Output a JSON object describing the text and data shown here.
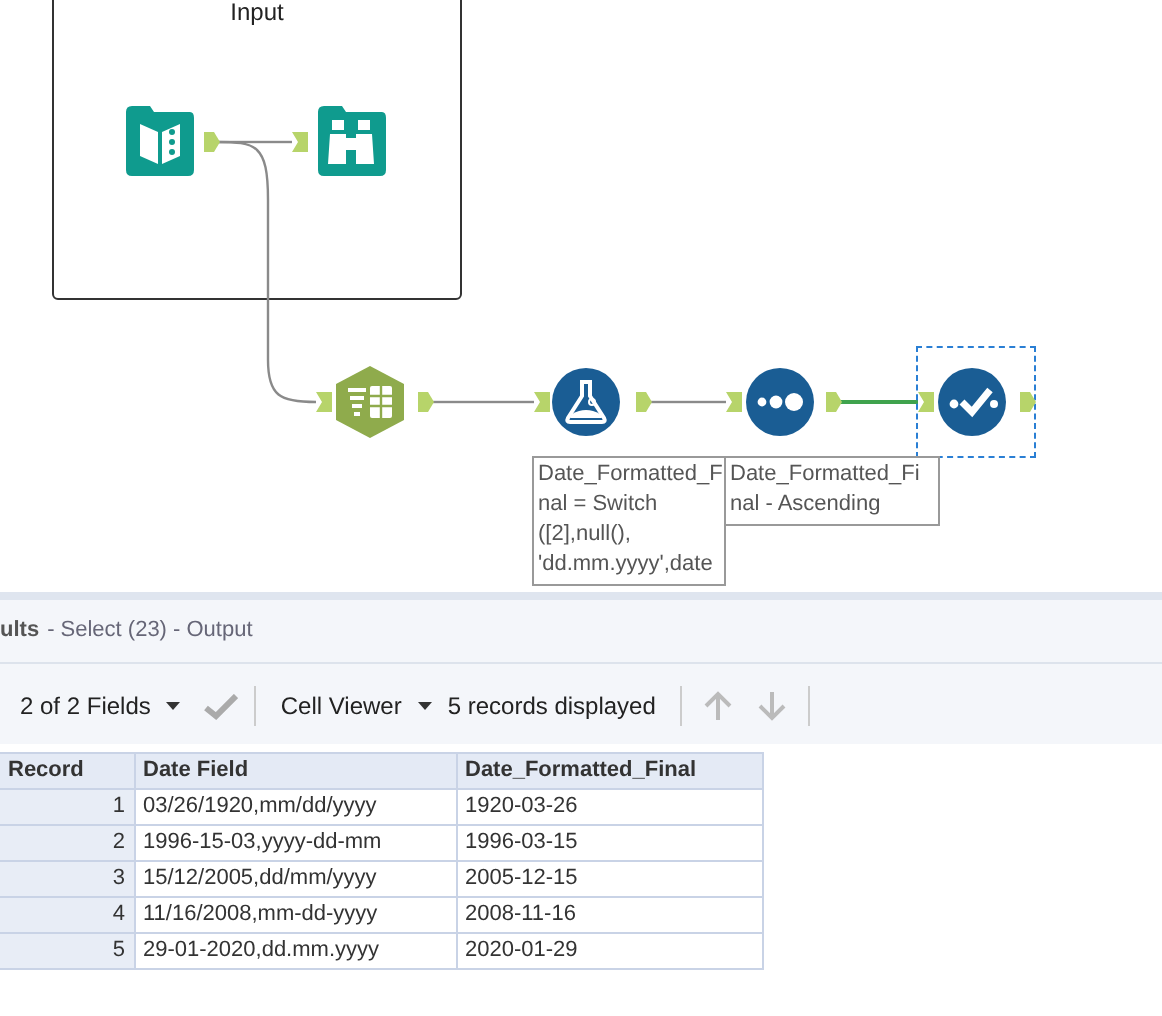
{
  "canvas": {
    "container": {
      "title": "Input"
    },
    "nodes": [
      {
        "kind": "input",
        "selected": false
      },
      {
        "kind": "browse",
        "selected": false
      },
      {
        "kind": "text-to-columns",
        "selected": false
      },
      {
        "kind": "formula",
        "selected": false
      },
      {
        "kind": "sort",
        "selected": false
      },
      {
        "kind": "select",
        "selected": true
      }
    ],
    "connections": [
      {
        "highlighted": false
      },
      {
        "highlighted": false
      },
      {
        "highlighted": false
      },
      {
        "highlighted": false
      },
      {
        "highlighted": true
      }
    ],
    "annotations": [
      {
        "lines": [
          "Date_Formatted_F",
          "nal = Switch",
          "([2],null(),",
          "'dd.mm.yyyy',date"
        ]
      },
      {
        "lines": [
          "Date_Formatted_Fi",
          "nal - Ascending"
        ]
      }
    ]
  },
  "results": {
    "title": "ults",
    "subtitle": "- Select (23) - Output",
    "toolbar": {
      "fields": "2 of 2 Fields",
      "viewer": "Cell Viewer",
      "records": "5 records displayed"
    },
    "table": {
      "columns": [
        "Record",
        "Date Field",
        "Date_Formatted_Final"
      ],
      "rows": [
        [
          "1",
          "03/26/1920,mm/dd/yyyy",
          "1920-03-26"
        ],
        [
          "2",
          "1996-15-03,yyyy-dd-mm",
          "1996-03-15"
        ],
        [
          "3",
          "15/12/2005,dd/mm/yyyy",
          "2005-12-15"
        ],
        [
          "4",
          "11/16/2008,mm-dd-yyyy",
          "2008-11-16"
        ],
        [
          "5",
          "29-01-2020,dd.mm.yyyy",
          "2020-01-29"
        ]
      ]
    }
  }
}
